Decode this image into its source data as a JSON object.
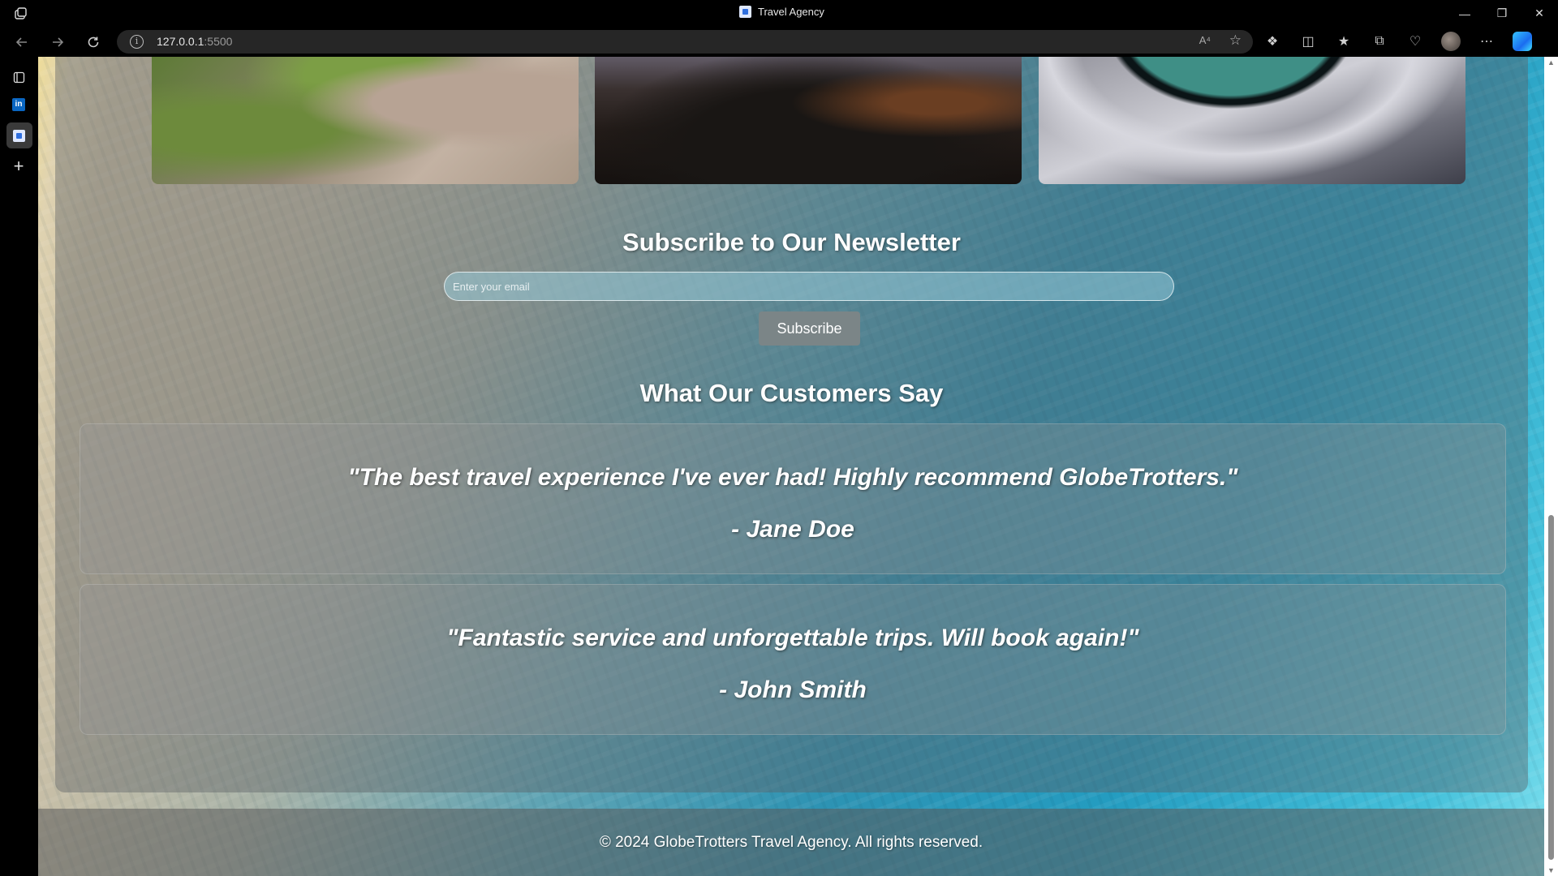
{
  "browser": {
    "tab_title": "Travel Agency",
    "url_host": "127.0.0.1",
    "url_port": ":5500",
    "read_aloud": "A⁴"
  },
  "sidebar": {
    "items": [
      {
        "name": "tab-actions-icon"
      },
      {
        "name": "linkedin-icon",
        "label": "in"
      },
      {
        "name": "travel-agency-tab-icon"
      },
      {
        "name": "add-icon"
      }
    ]
  },
  "newsletter": {
    "title": "Subscribe to Our Newsletter",
    "placeholder": "Enter your email",
    "button_label": "Subscribe"
  },
  "testimonials": {
    "title": "What Our Customers Say",
    "items": [
      {
        "quote": "\"The best travel experience I've ever had! Highly recommend GlobeTrotters.\"",
        "author": "- Jane Doe"
      },
      {
        "quote": "\"Fantastic service and unforgettable trips. Will book again!\"",
        "author": "- John Smith"
      }
    ]
  },
  "footer": {
    "text": "© 2024 GlobeTrotters Travel Agency. All rights reserved."
  }
}
